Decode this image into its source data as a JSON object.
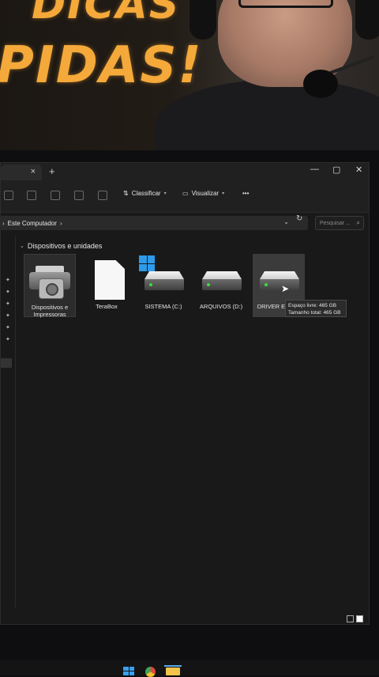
{
  "banner": {
    "line1": "DICAS",
    "line2": "PIDAS!"
  },
  "window": {
    "tab_close": "×",
    "new_tab": "+",
    "controls": {
      "minimize": "—",
      "maximize": "▢",
      "close": "✕"
    },
    "toolbar": {
      "sort_label": "Classificar",
      "view_label": "Visualizar",
      "more_label": "•••"
    },
    "address": {
      "path": "Este Computador",
      "chevron": "›"
    },
    "search": {
      "placeholder": "Pesquisar ..."
    },
    "section_title": "Dispositivos e unidades",
    "items": [
      {
        "label": "Dispositivos e Impressoras"
      },
      {
        "label": "TeraBox"
      },
      {
        "label": "SISTEMA (C:)"
      },
      {
        "label": "ARQUIVOS (D:)"
      },
      {
        "label": "DRIVER EX (E:)"
      }
    ],
    "tooltip": {
      "free": "Espaço livre: 465 GB",
      "total": "Tamanho total: 465 GB"
    }
  },
  "colors": {
    "accent": "#f4a93a",
    "window_bg": "#191919",
    "drive_led": "#3ddc3d"
  }
}
